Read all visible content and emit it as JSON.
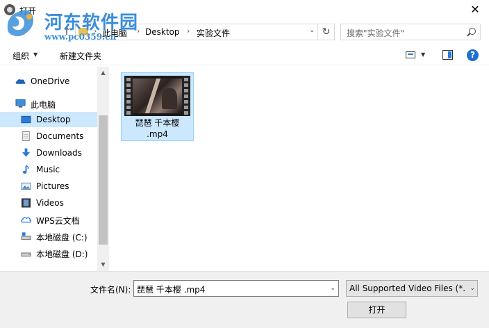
{
  "window": {
    "title": "打开",
    "close_glyph": "✕"
  },
  "watermark": {
    "name": "河东软件园",
    "url": "www.pc0359.cn"
  },
  "address": {
    "up_glyph": "↑",
    "crumbs": [
      "此电脑",
      "Desktop",
      "实验文件"
    ],
    "sep_glyph": "›",
    "dropdown_glyph": "⌄",
    "refresh_glyph": "↻"
  },
  "search": {
    "placeholder": "搜索\"实验文件\""
  },
  "toolbar": {
    "organize": "组织",
    "new_folder": "新建文件夹",
    "help_glyph": "?"
  },
  "nav": {
    "items": [
      {
        "label": "OneDrive",
        "icon": "onedrive-icon"
      },
      {
        "label": "此电脑",
        "icon": "computer-icon"
      },
      {
        "label": "Desktop",
        "icon": "desktop-icon",
        "selected": true
      },
      {
        "label": "Documents",
        "icon": "documents-icon"
      },
      {
        "label": "Downloads",
        "icon": "downloads-icon"
      },
      {
        "label": "Music",
        "icon": "music-icon"
      },
      {
        "label": "Pictures",
        "icon": "pictures-icon"
      },
      {
        "label": "Videos",
        "icon": "videos-icon"
      },
      {
        "label": "WPS云文档",
        "icon": "wps-cloud-icon"
      },
      {
        "label": "本地磁盘 (C:)",
        "icon": "drive-icon"
      },
      {
        "label": "本地磁盘 (D:)",
        "icon": "drive-icon"
      }
    ]
  },
  "files": [
    {
      "name_line1": "琵琶 千本樱",
      "name_line2": ".mp4",
      "icon": "video-thumbnail-icon"
    }
  ],
  "footer": {
    "filename_label": "文件名(N):",
    "filename_value": "琵琶 千本樱 .mp4",
    "filetype_value": "All Supported Video Files (*.",
    "open_label": "打开"
  },
  "colors": {
    "selection": "#cce8ff",
    "accent": "#2a7ad6",
    "watermark": "#3b8ed8"
  }
}
